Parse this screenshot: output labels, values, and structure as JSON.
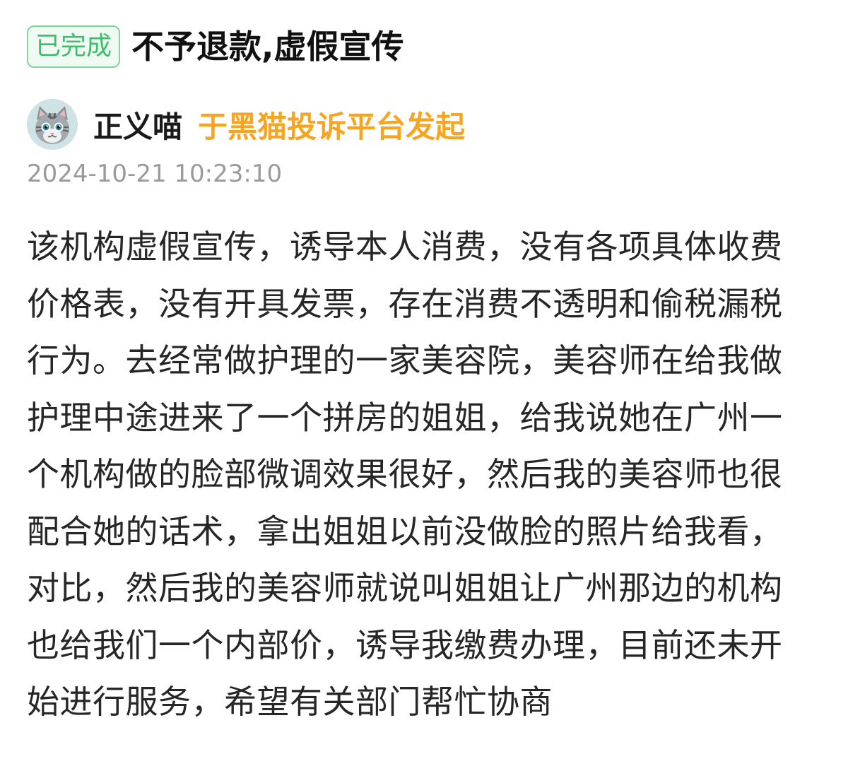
{
  "complaint": {
    "status_label": "已完成",
    "title": "不予退款,虚假宣传",
    "status_color": "#3cbf6a"
  },
  "author": {
    "name": "正义喵",
    "source": "于黑猫投诉平台发起",
    "avatar_icon": "cat-avatar-icon",
    "source_color": "#f7a51e"
  },
  "timestamp": "2024-10-21 10:23:10",
  "content": "该机构虚假宣传，诱导本人消费，没有各项具体收费价格表，没有开具发票，存在消费不透明和偷税漏税行为。去经常做护理的一家美容院，美容师在给我做护理中途进来了一个拼房的姐姐，给我说她在广州一个机构做的脸部微调效果很好，然后我的美容师也很配合她的话术，拿出姐姐以前没做脸的照片给我看，对比，然后我的美容师就说叫姐姐让广州那边的机构也给我们一个内部价，诱导我缴费办理，目前还未开始进行服务，希望有关部门帮忙协商"
}
